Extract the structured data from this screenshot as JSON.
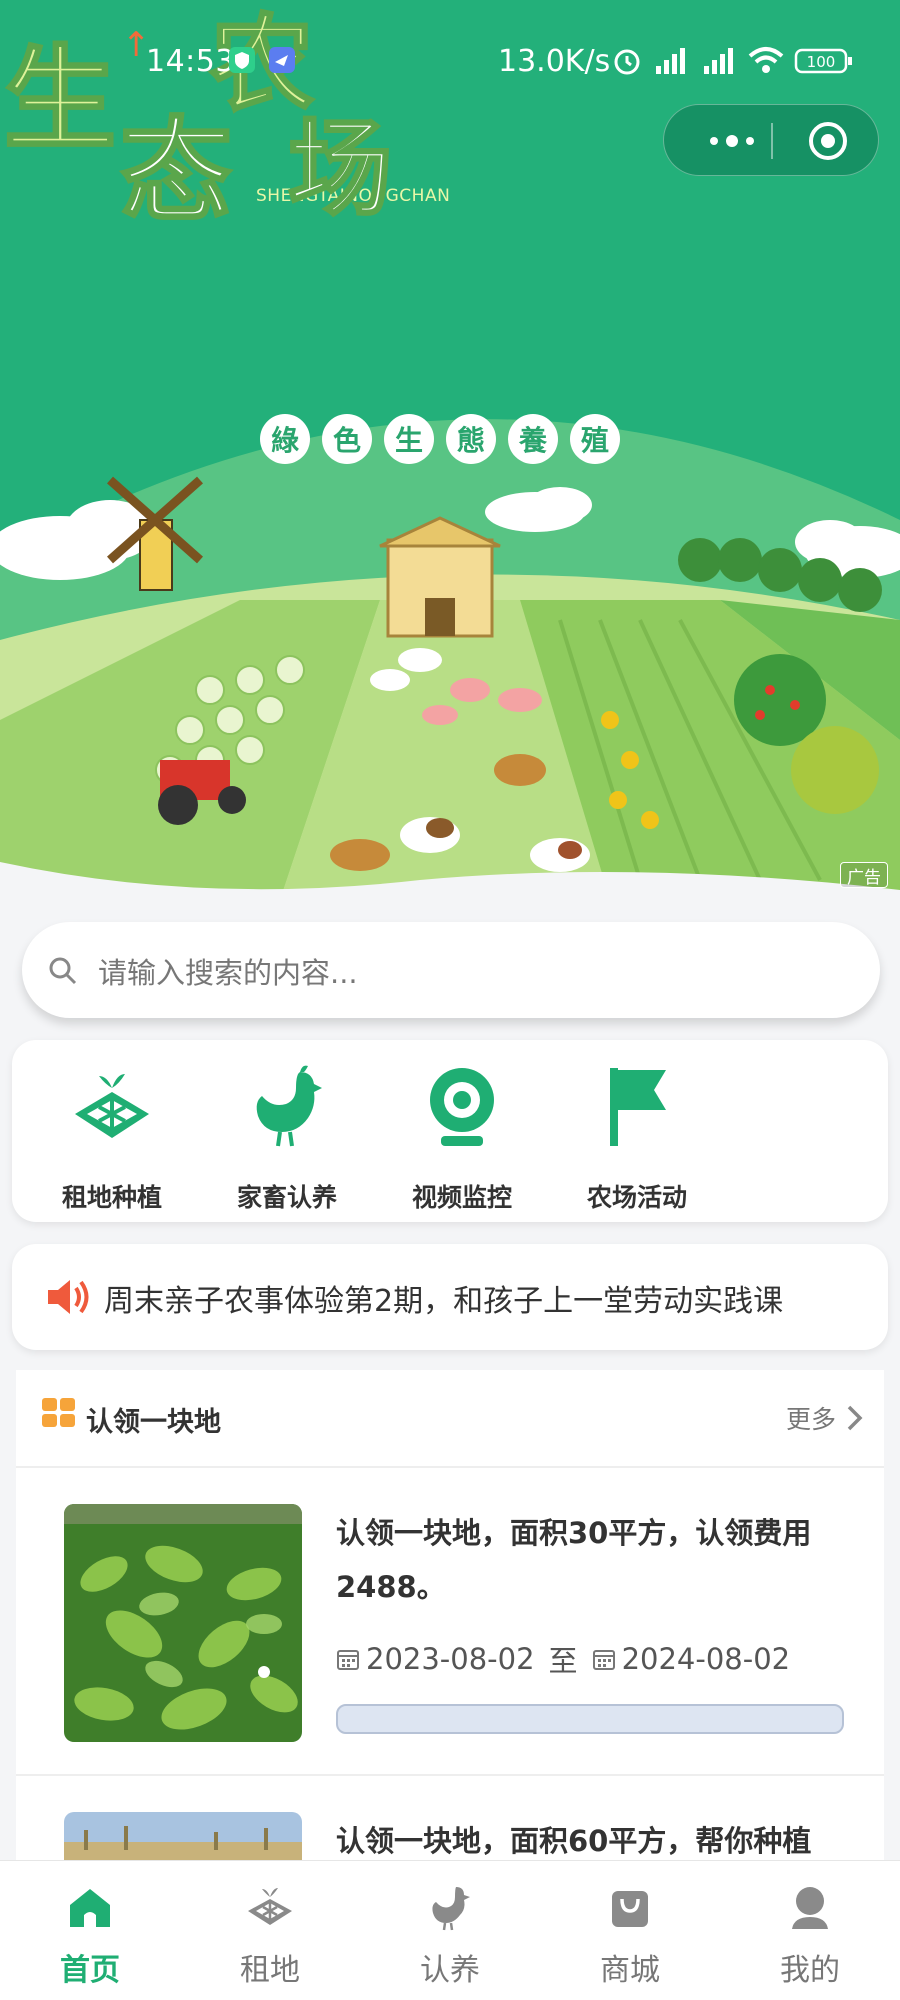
{
  "status_bar": {
    "time": "14:53",
    "network_speed": "13.0K/s",
    "battery": "100",
    "icons": [
      "shield-icon",
      "app-icon",
      "alarm-icon",
      "signal-hd-icon",
      "signal-hd-icon",
      "wifi-icon",
      "battery-icon"
    ]
  },
  "mini_program_capsule": {
    "icons": [
      "more-dots-icon",
      "close-target-icon"
    ]
  },
  "banner": {
    "subtitle": "SHENGTAINONGCHAN",
    "title_chars": [
      "生",
      "态",
      "农",
      "场"
    ],
    "tags": [
      "綠",
      "色",
      "生",
      "態",
      "養",
      "殖"
    ],
    "ad_badge": "广告",
    "colors": {
      "primary": "#23b07a",
      "title_light": "#dff29a",
      "title_white": "#ffffff"
    }
  },
  "search": {
    "placeholder": "请输入搜索的内容..."
  },
  "quick_nav": [
    {
      "label": "租地种植",
      "icon": "land-plot-icon"
    },
    {
      "label": "家畜认养",
      "icon": "chicken-icon"
    },
    {
      "label": "视频监控",
      "icon": "camera-icon"
    },
    {
      "label": "农场活动",
      "icon": "flag-icon"
    }
  ],
  "notice": {
    "text": "周末亲子农事体验第2期，和孩子上一堂劳动实践课",
    "icon": "speaker-icon"
  },
  "section": {
    "title": "认领一块地",
    "more": "更多",
    "items": [
      {
        "title": "认领一块地，面积30平方，认领费用2488。",
        "start": "2023-08-02",
        "sep": "至",
        "end": "2024-08-02",
        "progress": 0
      },
      {
        "title": "认领一块地，面积60平方，帮你种植"
      }
    ]
  },
  "tab_bar": {
    "tabs": [
      {
        "label": "首页",
        "icon": "home-icon",
        "active": true
      },
      {
        "label": "租地",
        "icon": "land-plot-icon",
        "active": false
      },
      {
        "label": "认养",
        "icon": "chicken-icon",
        "active": false
      },
      {
        "label": "商城",
        "icon": "shopping-bag-icon",
        "active": false
      },
      {
        "label": "我的",
        "icon": "user-icon",
        "active": false
      }
    ],
    "active_color": "#1fae73",
    "inactive_color": "#777777"
  }
}
